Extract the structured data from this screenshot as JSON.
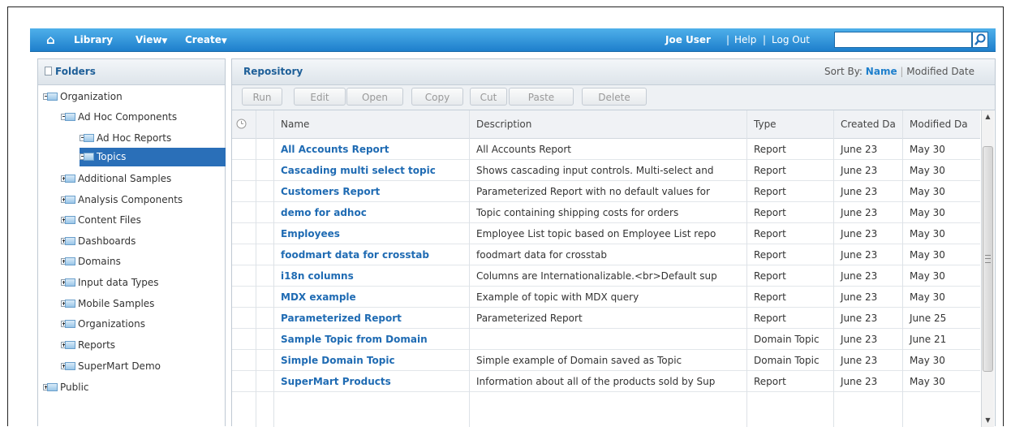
{
  "topbar": {
    "home_icon": "home-icon",
    "library": "Library",
    "view": "View",
    "create": "Create",
    "user": "Joe User",
    "sep": "|",
    "help": "Help",
    "logout": "Log Out",
    "search_value": "",
    "search_icon": "search-icon"
  },
  "folders": {
    "title": "Folders",
    "tree": [
      {
        "label": "Organization"
      },
      {
        "label": "Ad Hoc Components"
      },
      {
        "label": "Ad Hoc Reports"
      },
      {
        "label": "Topics"
      },
      {
        "label": "Additional Samples"
      },
      {
        "label": "Analysis Components"
      },
      {
        "label": "Content Files"
      },
      {
        "label": "Dashboards"
      },
      {
        "label": "Domains"
      },
      {
        "label": "Input data Types"
      },
      {
        "label": "Mobile Samples"
      },
      {
        "label": "Organizations"
      },
      {
        "label": "Reports"
      },
      {
        "label": "SuperMart Demo"
      },
      {
        "label": "Public"
      }
    ]
  },
  "repository": {
    "title": "Repository",
    "sort_label": "Sort By:",
    "sort_name": "Name",
    "sort_sep": "|",
    "sort_modified": "Modified Date",
    "toolbar": {
      "run": "Run",
      "edit": "Edit",
      "open": "Open",
      "copy": "Copy",
      "cut": "Cut",
      "paste": "Paste",
      "delete": "Delete"
    },
    "columns": {
      "name": "Name",
      "description": "Description",
      "type": "Type",
      "created": "Created Da",
      "modified": "Modified Da"
    },
    "rows": [
      {
        "name": "All Accounts Report",
        "description": "All Accounts Report",
        "type": "Report",
        "created": "June 23",
        "modified": "May 30"
      },
      {
        "name": "Cascading multi select topic",
        "description": "Shows cascading input controls. Multi-select and",
        "type": "Report",
        "created": "June 23",
        "modified": "May 30"
      },
      {
        "name": "Customers Report",
        "description": "Parameterized Report with no default values for",
        "type": "Report",
        "created": "June 23",
        "modified": "May 30"
      },
      {
        "name": "demo for adhoc",
        "description": "Topic containing shipping costs for orders",
        "type": "Report",
        "created": "June 23",
        "modified": "May 30"
      },
      {
        "name": "Employees",
        "description": "Employee List topic based on Employee List repo",
        "type": "Report",
        "created": "June 23",
        "modified": "May 30"
      },
      {
        "name": "foodmart data for crosstab",
        "description": "foodmart data for crosstab",
        "type": "Report",
        "created": "June 23",
        "modified": "May 30"
      },
      {
        "name": "i18n columns",
        "description": "Columns are Internationalizable.<br>Default sup",
        "type": "Report",
        "created": "June 23",
        "modified": "May 30"
      },
      {
        "name": "MDX example",
        "description": "Example of topic with MDX query",
        "type": "Report",
        "created": "June 23",
        "modified": "May 30"
      },
      {
        "name": "Parameterized Report",
        "description": "Parameterized Report",
        "type": "Report",
        "created": "June 23",
        "modified": "June 25"
      },
      {
        "name": "Sample Topic from Domain",
        "description": "",
        "type": "Domain Topic",
        "created": "June 23",
        "modified": "June 21"
      },
      {
        "name": "Simple Domain Topic",
        "description": "Simple example of Domain saved as Topic",
        "type": "Domain Topic",
        "created": "June 23",
        "modified": "May 30"
      },
      {
        "name": "SuperMart Products",
        "description": "Information about all of the products sold by Sup",
        "type": "Report",
        "created": "June 23",
        "modified": "May 30"
      }
    ]
  }
}
